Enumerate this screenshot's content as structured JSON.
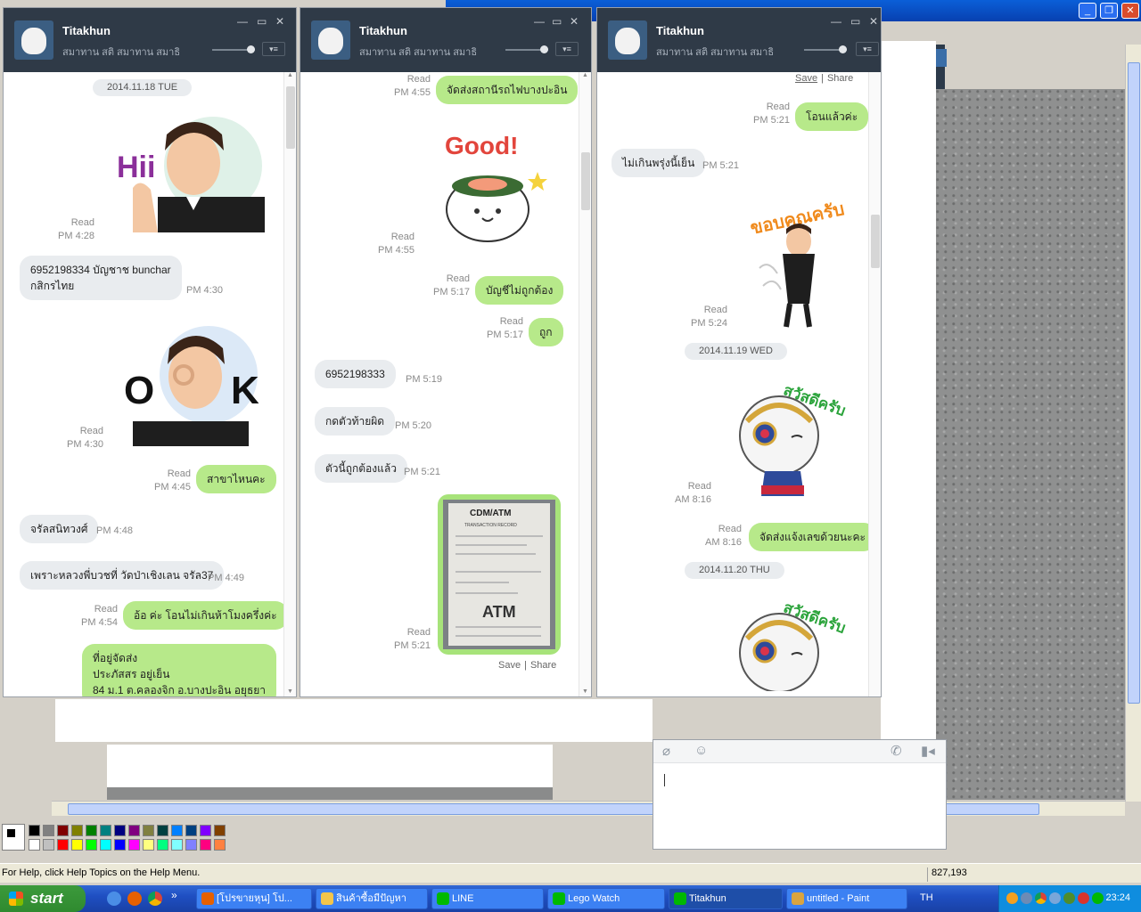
{
  "paint": {
    "status_help": "For Help, click Help Topics on the Help Menu.",
    "coords": "827,193",
    "palette": [
      "#000000",
      "#808080",
      "#800000",
      "#808000",
      "#008000",
      "#008080",
      "#000080",
      "#800080",
      "#808040",
      "#004040",
      "#0080ff",
      "#004080",
      "#8000ff",
      "#804000",
      "#ffffff",
      "#c0c0c0",
      "#ff0000",
      "#ffff00",
      "#00ff00",
      "#00ffff",
      "#0000ff",
      "#ff00ff",
      "#ffff80",
      "#00ff80",
      "#80ffff",
      "#8080ff",
      "#ff0080",
      "#ff8040"
    ]
  },
  "windows": [
    {
      "name": "Titakhun",
      "status": "สมาทาน สติ สมาทาน สมาธิ",
      "date": "2014.11.18 TUE",
      "items": [
        {
          "kind": "meta",
          "text1": "Read",
          "text2": "PM 4:28"
        },
        {
          "kind": "them",
          "text1": "6952198334 บัญชาช bunchar",
          "text2": "กสิกรไทย",
          "time": "PM 4:30"
        },
        {
          "kind": "meta",
          "text1": "Read",
          "text2": "PM 4:30"
        },
        {
          "kind": "me",
          "text": "สาขาไหนคะ",
          "read": "Read",
          "time": "PM 4:45"
        },
        {
          "kind": "them",
          "text": "จรัลสนิทวงศ์",
          "time": "PM 4:48"
        },
        {
          "kind": "them",
          "text": "เพราะหลวงพี่บวชที่ วัดป่าเชิงเลน จรัล37",
          "time": "PM 4:49"
        },
        {
          "kind": "me",
          "text": "อ้อ ค่ะ โอนไม่เกินห้าโมงครึ่งค่ะ",
          "read": "Read",
          "time": "PM 4:54"
        },
        {
          "kind": "me",
          "text1": "ที่อยู่จัดส่ง",
          "text2": "ประภัสสร อยู่เย็น",
          "text3": "84 ม.1 ต.คลองจิก อ.บางปะอิน อยุธยา"
        }
      ]
    },
    {
      "name": "Titakhun",
      "status": "สมาทาน สติ สมาทาน สมาธิ",
      "items": [
        {
          "kind": "me",
          "text": "จัดส่งสถานีรถไฟบางปะอิน",
          "read": "Read",
          "time": "PM 4:55"
        },
        {
          "kind": "meta",
          "text1": "Read",
          "text2": "PM 4:55"
        },
        {
          "kind": "me",
          "text": "บัญชีไม่ถูกต้อง",
          "read": "Read",
          "time": "PM 5:17"
        },
        {
          "kind": "me",
          "text": "ถูก",
          "read": "Read",
          "time": "PM 5:17"
        },
        {
          "kind": "them",
          "text": "6952198333",
          "time": "PM 5:19"
        },
        {
          "kind": "them",
          "text": "กดตัวท้ายผิด",
          "time": "PM 5:20"
        },
        {
          "kind": "them",
          "text": "ตัวนี้ถูกต้องแล้ว",
          "time": "PM 5:21"
        },
        {
          "kind": "meta",
          "text1": "Read",
          "text2": "PM 5:21"
        },
        {
          "kind": "save",
          "save": "Save",
          "share": "Share"
        }
      ],
      "sticker_good": "Good!",
      "receipt": {
        "title": "CDM/ATM",
        "sub": "TRANSACTION RECORD",
        "brand": "ATM"
      }
    },
    {
      "name": "Titakhun",
      "status": "สมาทาน สติ สมาทาน สมาธิ",
      "save": "Save",
      "share": "Share",
      "items": [
        {
          "kind": "me",
          "text": "โอนแล้วค่ะ",
          "read": "Read",
          "time": "PM 5:21"
        },
        {
          "kind": "them",
          "text": "ไม่เกินพรุ่งนี้เย็น",
          "time": "PM 5:21"
        },
        {
          "kind": "meta",
          "text1": "Read",
          "text2": "PM 5:24"
        },
        {
          "kind": "date",
          "text": "2014.11.19 WED"
        },
        {
          "kind": "meta",
          "text1": "Read",
          "text2": "AM 8:16"
        },
        {
          "kind": "me",
          "text": "จัดส่งแจ้งเลขด้วยนะคะ",
          "read": "Read",
          "time": "AM 8:16"
        },
        {
          "kind": "date",
          "text": "2014.11.20 THU"
        }
      ],
      "sticker_thanks": "ขอบคุณครับ",
      "sticker_hello": "สวัสดีครับ"
    }
  ],
  "stickers": {
    "hii": "Hii",
    "ok1": "O",
    "ok2": "K"
  },
  "taskbar": {
    "start": "start",
    "lang": "TH",
    "clock": "23:24",
    "tasks": [
      {
        "label": "[โปรขายหุน] โป...",
        "color": "#e66000"
      },
      {
        "label": "สินค้าซื้อมีปัญหา",
        "color": "#f3c54b"
      },
      {
        "label": "LINE",
        "color": "#00b900"
      },
      {
        "label": "Lego Watch",
        "color": "#00b900"
      },
      {
        "label": "Titakhun",
        "color": "#00b900"
      },
      {
        "label": "untitled - Paint",
        "color": "#d9a440"
      }
    ]
  }
}
